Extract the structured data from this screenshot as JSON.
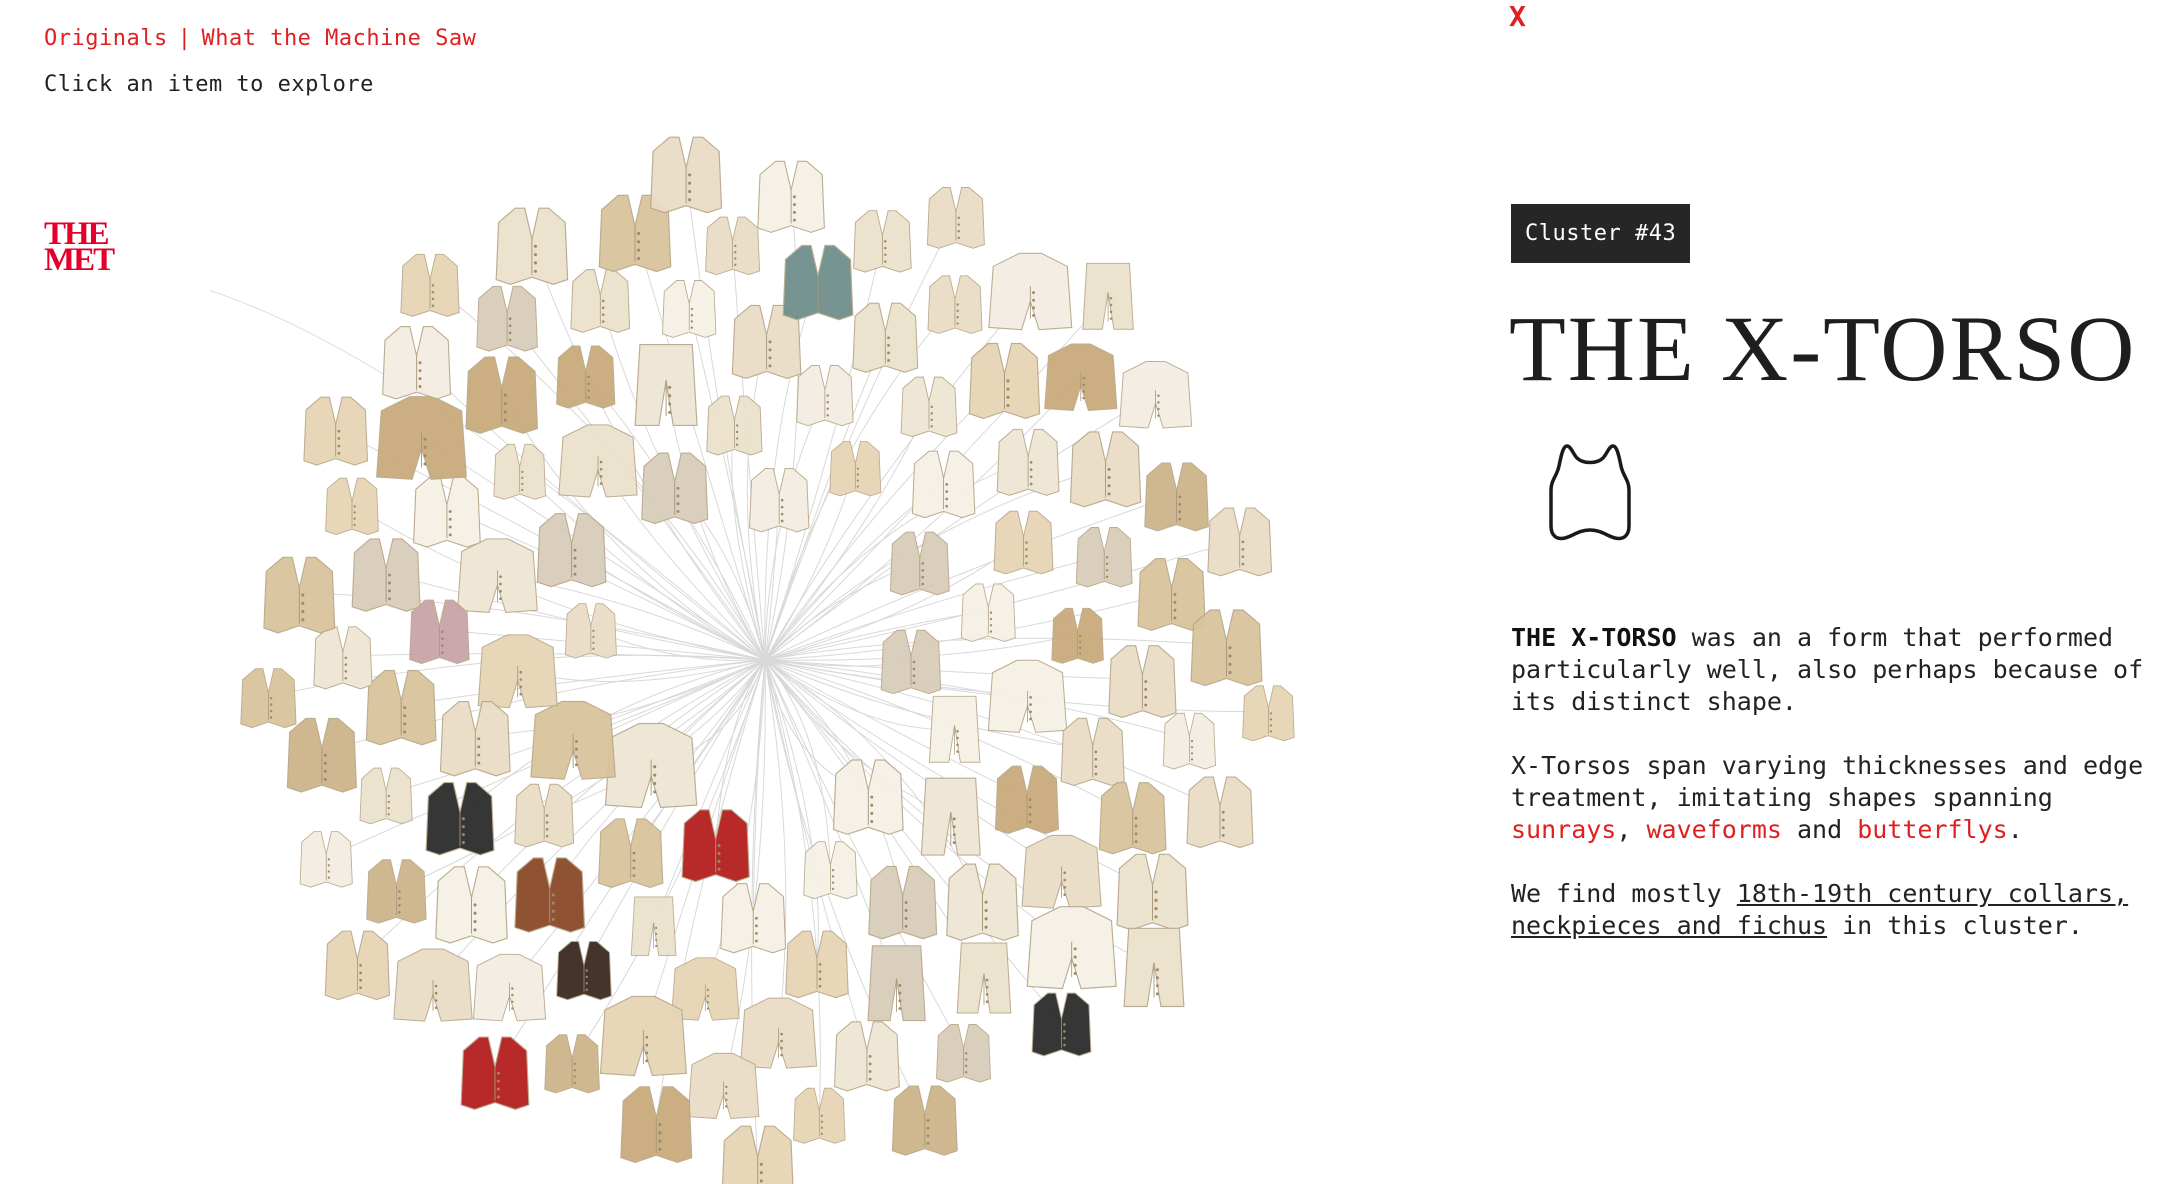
{
  "nav": {
    "originals": "Originals",
    "separator": "|",
    "what_machine_saw": "What the Machine Saw"
  },
  "hint": "Click an item to explore",
  "logo": {
    "line1": "THE",
    "line2": "MET"
  },
  "close_label": "X",
  "badge": "Cluster #43",
  "title": "THE X-TORSO",
  "shape_icon": "x-torso-shape-icon",
  "description": {
    "p1_bold": "THE X-TORSO",
    "p1_rest": " was an a form that performed particularly well, also perhaps because of its distinct shape.",
    "p2_pre": "X-Torsos span varying thicknesses and edge treatment, imitating shapes spanning ",
    "p2_link1": "sunrays",
    "p2_mid1": ", ",
    "p2_link2": "waveforms",
    "p2_mid2": " and ",
    "p2_link3": "butterflys",
    "p2_end": ".",
    "p3_pre": "We find mostly ",
    "p3_link": "18th-19th century collars, neckpieces and fichus",
    "p3_end": " in this cluster."
  },
  "colors": {
    "accent": "#e02020",
    "met_red": "#e4002b",
    "badge_bg": "#262626",
    "garment_palette": [
      "#efe6d4",
      "#e6d5b5",
      "#d9c39b",
      "#f3ede2",
      "#cdb48a",
      "#e9ddc6",
      "#d8cdb9",
      "#f6f1e6",
      "#c9ab7c",
      "#ece2cc"
    ],
    "garment_accents": [
      "#2c2c2c",
      "#b51f1f",
      "#6f8f8c",
      "#8a4a2a",
      "#3a2a20",
      "#c9a4a8"
    ]
  },
  "cluster": {
    "label": "garment-cluster",
    "item_count": 112,
    "center": "sunburst-center"
  }
}
